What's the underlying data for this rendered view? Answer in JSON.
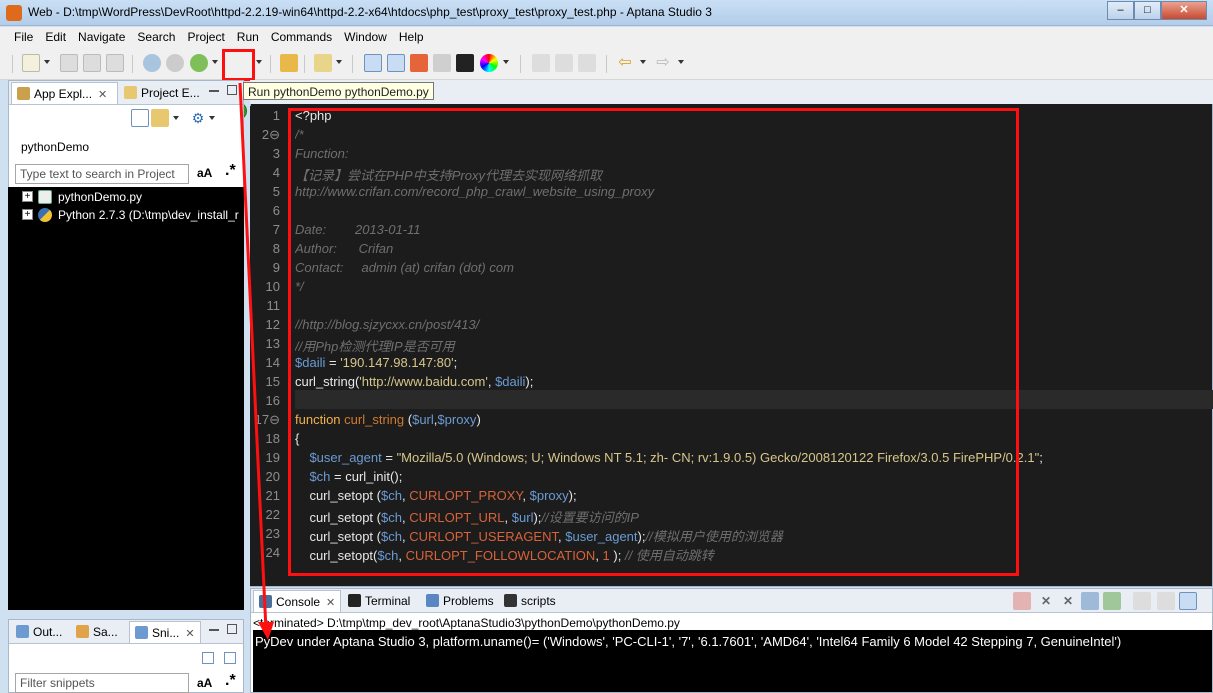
{
  "window": {
    "title": "Web - D:\\tmp\\WordPress\\DevRoot\\httpd-2.2.19-win64\\httpd-2.2-x64\\htdocs\\php_test\\proxy_test\\proxy_test.php - Aptana Studio 3"
  },
  "menu": [
    "File",
    "Edit",
    "Navigate",
    "Search",
    "Project",
    "Run",
    "Commands",
    "Window",
    "Help"
  ],
  "tooltip": "Run pythonDemo pythonDemo.py",
  "left_pane": {
    "tabs": [
      "App Expl...",
      "Project E..."
    ],
    "project_select": "pythonDemo",
    "search_placeholder": "Type text to search in Project",
    "case_toggle": "aA",
    "regex_toggle": ".*",
    "tree": [
      {
        "label": "pythonDemo.py"
      },
      {
        "label": "Python 2.7.3  (D:\\tmp\\dev_install_r"
      }
    ]
  },
  "left_pane2": {
    "tabs": [
      "Out...",
      "Sa...",
      "Sni..."
    ],
    "filter_placeholder": "Filter snippets",
    "case_toggle": "aA",
    "regex_toggle": ".*"
  },
  "editor": {
    "lines": [
      {
        "n": "1",
        "fold": false,
        "parts": [
          {
            "t": "<?php",
            "c": "plain"
          }
        ]
      },
      {
        "n": "2",
        "fold": true,
        "parts": [
          {
            "t": "/*",
            "c": "cmt"
          }
        ]
      },
      {
        "n": "3",
        "fold": false,
        "parts": [
          {
            "t": "Function:",
            "c": "cmt"
          }
        ]
      },
      {
        "n": "4",
        "fold": false,
        "parts": [
          {
            "t": "【记录】尝试在PHP中支持Proxy代理去实现网络抓取",
            "c": "cmt"
          }
        ]
      },
      {
        "n": "5",
        "fold": false,
        "parts": [
          {
            "t": "http://www.crifan.com/record_php_crawl_website_using_proxy",
            "c": "cmt"
          }
        ]
      },
      {
        "n": "6",
        "fold": false,
        "parts": []
      },
      {
        "n": "7",
        "fold": false,
        "parts": [
          {
            "t": "Date:        2013-01-11",
            "c": "cmt"
          }
        ]
      },
      {
        "n": "8",
        "fold": false,
        "parts": [
          {
            "t": "Author:      Crifan",
            "c": "cmt"
          }
        ]
      },
      {
        "n": "9",
        "fold": false,
        "parts": [
          {
            "t": "Contact:     admin (at) crifan (dot) com",
            "c": "cmt"
          }
        ]
      },
      {
        "n": "10",
        "fold": false,
        "parts": [
          {
            "t": "*/",
            "c": "cmt"
          }
        ]
      },
      {
        "n": "11",
        "fold": false,
        "parts": []
      },
      {
        "n": "12",
        "fold": false,
        "parts": [
          {
            "t": "//http://blog.sjzycxx.cn/post/413/",
            "c": "cmt"
          }
        ]
      },
      {
        "n": "13",
        "fold": false,
        "parts": [
          {
            "t": "//用Php检测代理IP是否可用",
            "c": "cmt"
          }
        ]
      },
      {
        "n": "14",
        "fold": false,
        "parts": [
          {
            "t": "$daili",
            "c": "var"
          },
          {
            "t": " = ",
            "c": "plain"
          },
          {
            "t": "'190.147.98.147:80'",
            "c": "str"
          },
          {
            "t": ";",
            "c": "plain"
          }
        ]
      },
      {
        "n": "15",
        "fold": false,
        "parts": [
          {
            "t": "curl_string(",
            "c": "plain"
          },
          {
            "t": "'http://www.baidu.com'",
            "c": "str"
          },
          {
            "t": ", ",
            "c": "plain"
          },
          {
            "t": "$daili",
            "c": "var"
          },
          {
            "t": ");",
            "c": "plain"
          }
        ]
      },
      {
        "n": "16",
        "fold": false,
        "parts": []
      },
      {
        "n": "17",
        "fold": true,
        "parts": [
          {
            "t": "function",
            "c": "kw"
          },
          {
            "t": " ",
            "c": "plain"
          },
          {
            "t": "curl_string",
            "c": "fn"
          },
          {
            "t": " (",
            "c": "plain"
          },
          {
            "t": "$url",
            "c": "var"
          },
          {
            "t": ",",
            "c": "plain"
          },
          {
            "t": "$proxy",
            "c": "var"
          },
          {
            "t": ")",
            "c": "plain"
          }
        ]
      },
      {
        "n": "18",
        "fold": false,
        "parts": [
          {
            "t": "{",
            "c": "plain"
          }
        ]
      },
      {
        "n": "19",
        "fold": false,
        "parts": [
          {
            "t": "    ",
            "c": "plain"
          },
          {
            "t": "$user_agent",
            "c": "var"
          },
          {
            "t": " = ",
            "c": "plain"
          },
          {
            "t": "\"Mozilla/5.0 (Windows; U; Windows NT 5.1; zh- CN; rv:1.9.0.5) Gecko/2008120122 Firefox/3.0.5 FirePHP/0.2.1\"",
            "c": "str"
          },
          {
            "t": ";",
            "c": "plain"
          }
        ]
      },
      {
        "n": "20",
        "fold": false,
        "parts": [
          {
            "t": "    ",
            "c": "plain"
          },
          {
            "t": "$ch",
            "c": "var"
          },
          {
            "t": " = curl_init();",
            "c": "plain"
          }
        ]
      },
      {
        "n": "21",
        "fold": false,
        "parts": [
          {
            "t": "    curl_setopt (",
            "c": "plain"
          },
          {
            "t": "$ch",
            "c": "var"
          },
          {
            "t": ", ",
            "c": "plain"
          },
          {
            "t": "CURLOPT_PROXY",
            "c": "const"
          },
          {
            "t": ", ",
            "c": "plain"
          },
          {
            "t": "$proxy",
            "c": "var"
          },
          {
            "t": ");",
            "c": "plain"
          }
        ]
      },
      {
        "n": "22",
        "fold": false,
        "parts": [
          {
            "t": "    curl_setopt (",
            "c": "plain"
          },
          {
            "t": "$ch",
            "c": "var"
          },
          {
            "t": ", ",
            "c": "plain"
          },
          {
            "t": "CURLOPT_URL",
            "c": "const"
          },
          {
            "t": ", ",
            "c": "plain"
          },
          {
            "t": "$url",
            "c": "var"
          },
          {
            "t": ");",
            "c": "plain"
          },
          {
            "t": "//设置要访问的IP",
            "c": "cmt"
          }
        ]
      },
      {
        "n": "23",
        "fold": false,
        "parts": [
          {
            "t": "    curl_setopt (",
            "c": "plain"
          },
          {
            "t": "$ch",
            "c": "var"
          },
          {
            "t": ", ",
            "c": "plain"
          },
          {
            "t": "CURLOPT_USERAGENT",
            "c": "const"
          },
          {
            "t": ", ",
            "c": "plain"
          },
          {
            "t": "$user_agent",
            "c": "var"
          },
          {
            "t": ");",
            "c": "plain"
          },
          {
            "t": "//模拟用户使用的浏览器",
            "c": "cmt"
          }
        ]
      },
      {
        "n": "24",
        "fold": false,
        "parts": [
          {
            "t": "    curl_setopt(",
            "c": "plain"
          },
          {
            "t": "$ch",
            "c": "var"
          },
          {
            "t": ", ",
            "c": "plain"
          },
          {
            "t": "CURLOPT_FOLLOWLOCATION",
            "c": "const"
          },
          {
            "t": ", ",
            "c": "plain"
          },
          {
            "t": "1",
            "c": "const"
          },
          {
            "t": " ); ",
            "c": "plain"
          },
          {
            "t": "// 使用自动跳转",
            "c": "cmt"
          }
        ]
      }
    ]
  },
  "console": {
    "tabs": [
      "Console",
      "Terminal",
      "Problems",
      "scripts"
    ],
    "status": "<terminated> D:\\tmp\\tmp_dev_root\\AptanaStudio3\\pythonDemo\\pythonDemo.py",
    "output": "PyDev under Aptana Studio 3, platform.uname()= ('Windows', 'PC-CLI-1', '7', '6.1.7601', 'AMD64', 'Intel64 Family 6 Model 42 Stepping 7, GenuineIntel')"
  },
  "colors": {
    "highlight_red": "#ff1010",
    "editor_bg": "#1c1c1c"
  }
}
